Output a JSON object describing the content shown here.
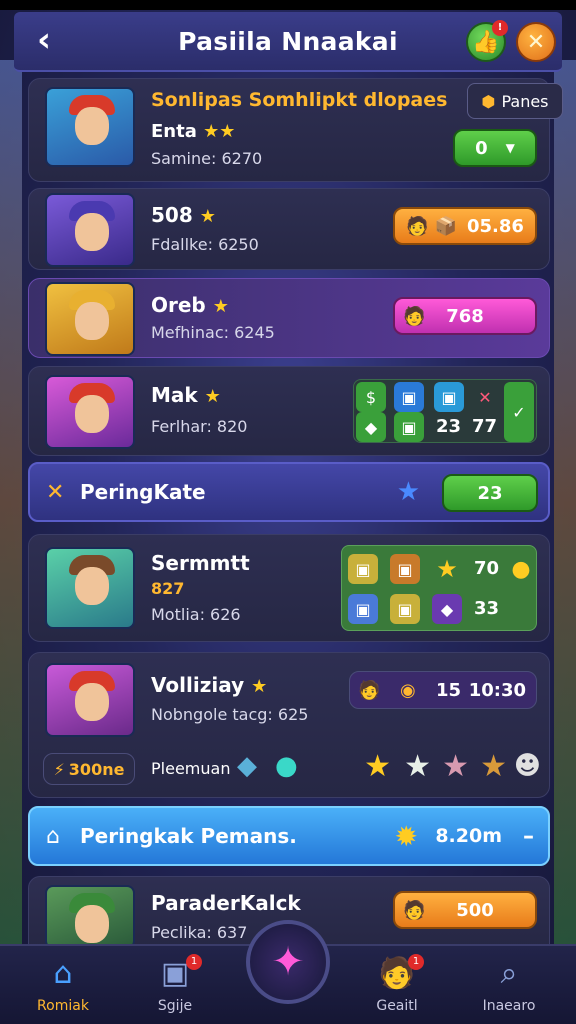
{
  "header": {
    "title": "Pasiila Nnaakai",
    "back_icon": "chevron-left-icon",
    "action_icon": "thumbs-up-icon",
    "action_badge": "!",
    "close_icon": "close-icon"
  },
  "banner": {
    "title": "Sonlipas Somhlipkt dlopaes",
    "button_label": "Panes"
  },
  "entries": [
    {
      "name": "Enta",
      "sub": "Samine: 6270",
      "action": "0"
    },
    {
      "name": "508",
      "sub": "Fdallke: 6250",
      "action": "05.86"
    },
    {
      "name": "Oreb",
      "sub": "Mefhinac: 6245",
      "action": "768"
    },
    {
      "name": "Mak",
      "sub": "Ferlhar: 820",
      "nums": [
        "23",
        "77"
      ]
    }
  ],
  "section1": {
    "label": "PeringKate",
    "value": "23"
  },
  "hero": {
    "name": "Sermmtt",
    "gold": "827",
    "sub": "Motlia: 626",
    "nums": [
      "70",
      "33"
    ]
  },
  "hero2": {
    "name": "Volliziay",
    "sub": "Nobngole tacg: 625",
    "badge": "300ne",
    "label": "Pleemuan",
    "nums": [
      "15",
      "10:30"
    ]
  },
  "section2": {
    "label": "Peringkak Pemans.",
    "value": "8.20m",
    "dash": "–"
  },
  "last": {
    "name": "ParaderKalck",
    "sub": "Peclika: 637",
    "value": "500"
  },
  "nav": {
    "items": [
      {
        "label": "Romiak",
        "icon": "home-icon"
      },
      {
        "label": "Sgije",
        "icon": "chat-icon",
        "badge": "1"
      },
      {
        "label": "Geaitl",
        "icon": "player-icon",
        "badge": "1"
      },
      {
        "label": "Inaearo",
        "icon": "search-icon"
      }
    ],
    "center_icon": "star-burst-icon"
  },
  "colors": {
    "accent": "#ffb830",
    "green": "#2f9a2a",
    "violet": "#4447a8",
    "blue": "#2478d8"
  }
}
